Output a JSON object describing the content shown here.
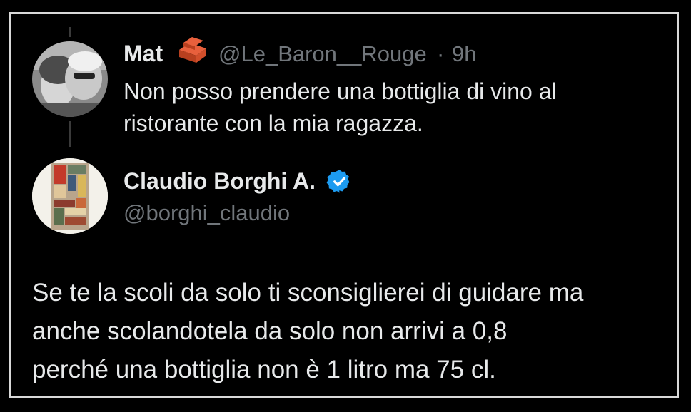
{
  "quoted_tweet": {
    "author_name": "Mat",
    "author_handle": "@Le_Baron__Rouge",
    "separator": "·",
    "time": "9h",
    "name_emoji": "brick-icon",
    "text_lines": [
      "Non posso prendere una bottiglia di vino al",
      "ristorante con la mia ragazza."
    ]
  },
  "reply_tweet": {
    "author_name": "Claudio Borghi A.",
    "author_handle": "@borghi_claudio",
    "verified_icon": "verified-badge-icon",
    "verified_color": "#1d9bf0",
    "text_lines": [
      "Se te la scoli da solo ti sconsiglierei di guidare ma",
      "anche scolandotela da solo non arrivi a 0,8",
      "perché una bottiglia non è 1 litro ma 75 cl."
    ]
  }
}
